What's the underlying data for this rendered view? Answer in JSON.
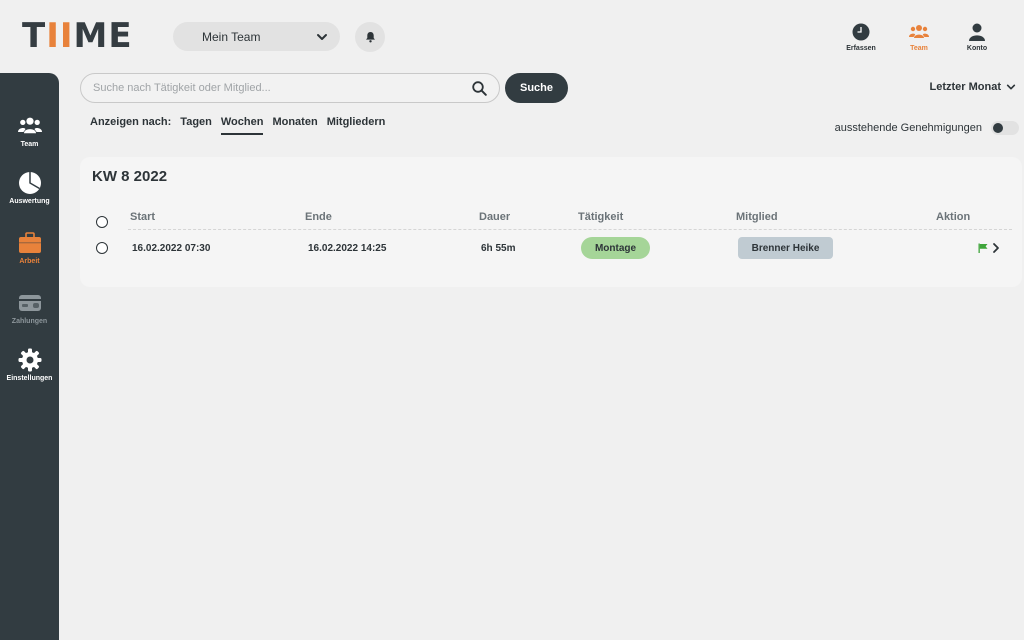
{
  "logo": {
    "text_pre": "T",
    "text_ii": "II",
    "text_post": "ME"
  },
  "header": {
    "team_select": "Mein Team",
    "nav": [
      {
        "label": "Erfassen",
        "icon": "clock-icon"
      },
      {
        "label": "Team",
        "icon": "team-icon"
      },
      {
        "label": "Konto",
        "icon": "user-icon"
      }
    ]
  },
  "sidebar": {
    "items": [
      {
        "label": "Team",
        "icon": "team-icon"
      },
      {
        "label": "Auswertung",
        "icon": "pie-chart-icon"
      },
      {
        "label": "Arbeit",
        "icon": "briefcase-icon"
      },
      {
        "label": "Zahlungen",
        "icon": "wallet-icon"
      },
      {
        "label": "Einstellungen",
        "icon": "gear-icon"
      }
    ]
  },
  "search": {
    "placeholder": "Suche nach Tätigkeit oder Mitglied...",
    "value": "",
    "button": "Suche"
  },
  "period": {
    "label": "Letzter Monat"
  },
  "viewby": {
    "caption": "Anzeigen nach:",
    "options": [
      "Tagen",
      "Wochen",
      "Monaten",
      "Mitgliedern"
    ],
    "active": "Wochen"
  },
  "pending": {
    "label": "ausstehende Genehmigungen",
    "on": false
  },
  "colors": {
    "accent": "#e8823b",
    "dark": "#323c41",
    "activity": "#a5d598",
    "member": "#c0cbd2",
    "flag": "#3ea53a"
  },
  "week": {
    "title": "KW 8 2022",
    "columns": [
      "Start",
      "Ende",
      "Dauer",
      "Tätigkeit",
      "Mitglied",
      "Aktion"
    ],
    "rows": [
      {
        "start": "16.02.2022 07:30",
        "end": "16.02.2022 14:25",
        "duration": "6h 55m",
        "activity": "Montage",
        "member": "Brenner Heike"
      }
    ]
  }
}
